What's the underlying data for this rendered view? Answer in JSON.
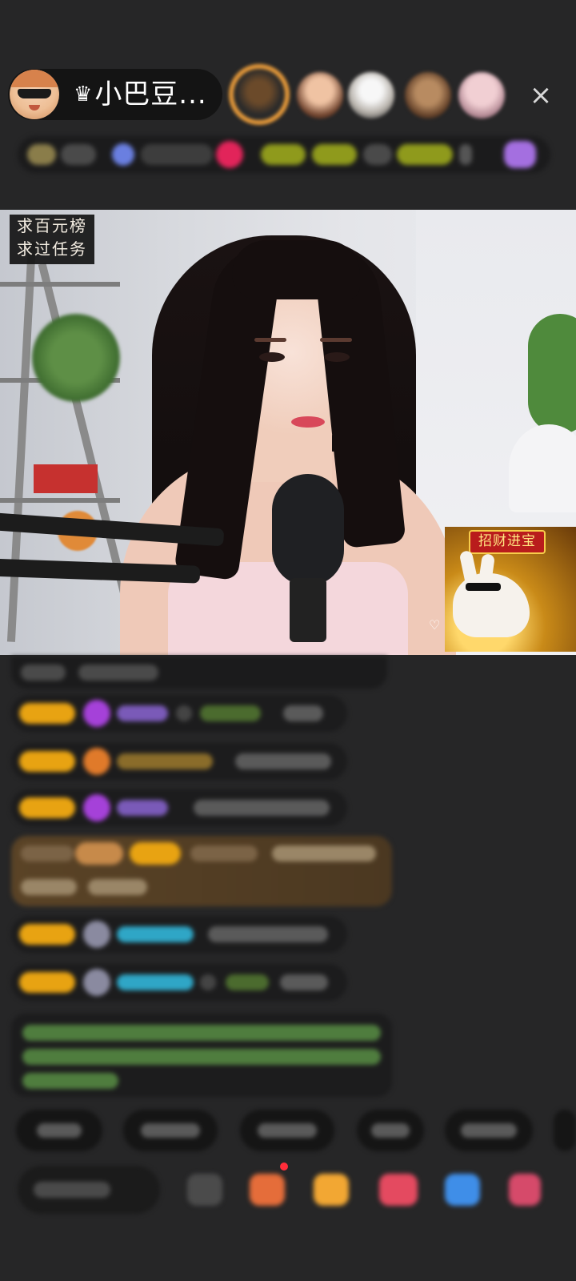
{
  "host": {
    "name": "小巴豆...",
    "crown_glyph": "♛"
  },
  "close_glyph": "×",
  "task_badge": {
    "line1": "求百元榜",
    "line2": "求过任务"
  },
  "fortune_sticker": {
    "title": "招财进宝"
  },
  "video": {
    "heart_glyph": "♡"
  },
  "colors": {
    "background": "#262627",
    "level_badge": "#e8a312",
    "gift_highlight": "#5a4326",
    "name_purple": "#7a5ab8",
    "name_cyan": "#2fa6c6",
    "system_text_green": "#5fa04a"
  }
}
